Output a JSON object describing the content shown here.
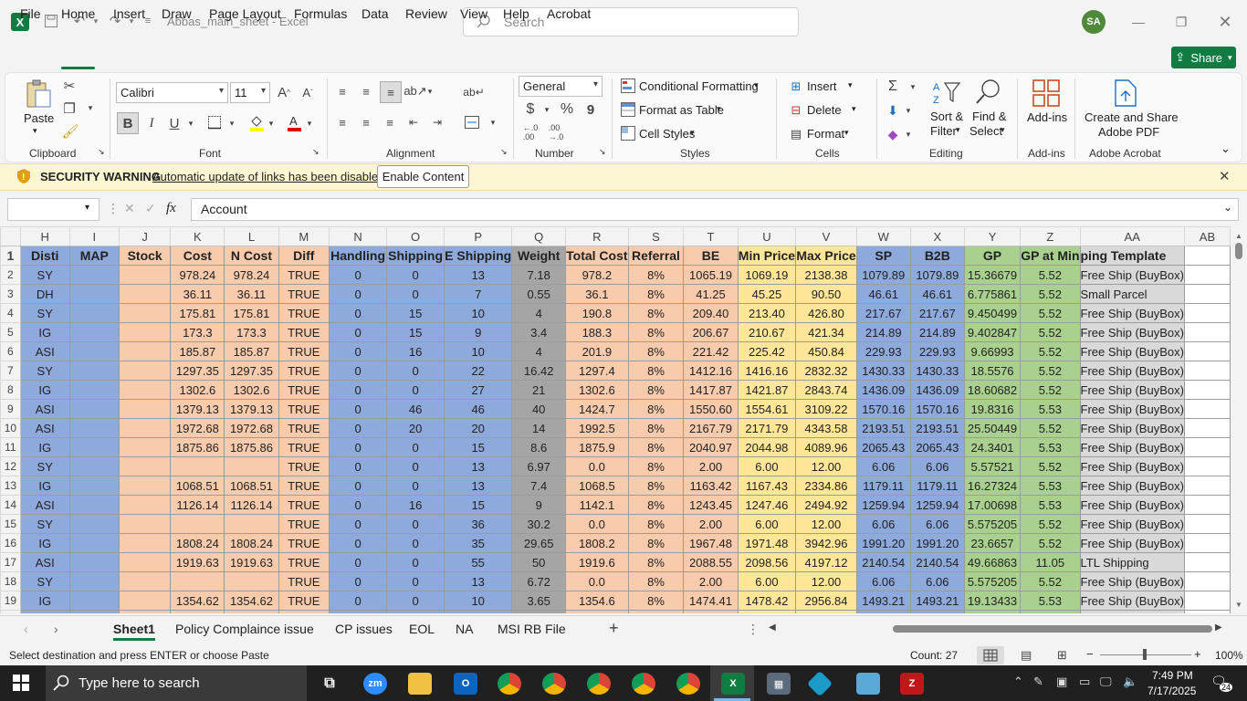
{
  "app": {
    "doc_title": "Abbas_main_sheet  -  Excel",
    "search_placeholder": "Search",
    "user_initials": "SA"
  },
  "menu": {
    "items": [
      "File",
      "Home",
      "Insert",
      "Draw",
      "Page Layout",
      "Formulas",
      "Data",
      "Review",
      "View",
      "Help",
      "Acrobat"
    ],
    "share": "Share"
  },
  "ribbon": {
    "clipboard": {
      "label": "Clipboard",
      "paste": "Paste"
    },
    "font": {
      "label": "Font",
      "name": "Calibri",
      "size": "11",
      "bold": "B",
      "italic": "I",
      "underline": "U"
    },
    "alignment": {
      "label": "Alignment"
    },
    "number": {
      "label": "Number",
      "format": "General",
      "currency": "$",
      "percent": "%",
      "comma": "9"
    },
    "styles": {
      "label": "Styles",
      "conditional": "Conditional Formatting",
      "format_table": "Format as Table",
      "cell_styles": "Cell Styles"
    },
    "cells": {
      "label": "Cells",
      "insert": "Insert",
      "delete": "Delete",
      "format": "Format"
    },
    "editing": {
      "label": "Editing",
      "sort_filter": "Sort &",
      "sort_filter2": "Filter",
      "find_select": "Find &",
      "find_select2": "Select"
    },
    "addins": {
      "label": "Add-ins",
      "addins": "Add-ins"
    },
    "acrobat": {
      "label": "Adobe Acrobat",
      "create": "Create and Share",
      "create2": "Adobe PDF"
    }
  },
  "warning": {
    "title": "SECURITY WARNING",
    "message": "Automatic update of links has been disabled",
    "button": "Enable Content"
  },
  "formula_bar": {
    "name_box": "",
    "fx": "fx",
    "value": "Account"
  },
  "sheet": {
    "columns": [
      "H",
      "I",
      "J",
      "K",
      "L",
      "M",
      "N",
      "O",
      "P",
      "Q",
      "R",
      "S",
      "T",
      "U",
      "V",
      "W",
      "X",
      "Y",
      "Z",
      "AA",
      "AB"
    ],
    "headers": [
      "Disti",
      "MAP",
      "Stock",
      "Cost",
      "N Cost",
      "Diff",
      "Handling",
      "Shipping",
      "E Shipping",
      "Weight",
      "Total Cost",
      "Referral",
      "BE",
      "Min Price",
      "Max Price",
      "SP",
      "B2B",
      "GP",
      "GP at Min",
      "ping Template",
      ""
    ],
    "rows": [
      {
        "n": "2",
        "c": [
          "SY",
          "",
          "",
          "978.24",
          "978.24",
          "TRUE",
          "0",
          "0",
          "13",
          "7.18",
          "978.2",
          "8%",
          "1065.19",
          "1069.19",
          "2138.38",
          "1079.89",
          "1079.89",
          "15.36679",
          "5.52",
          "Free Ship (BuyBox)",
          ""
        ]
      },
      {
        "n": "3",
        "c": [
          "DH",
          "",
          "",
          "36.11",
          "36.11",
          "TRUE",
          "0",
          "0",
          "7",
          "0.55",
          "36.1",
          "8%",
          "41.25",
          "45.25",
          "90.50",
          "46.61",
          "46.61",
          "6.775861",
          "5.52",
          "Small Parcel",
          ""
        ]
      },
      {
        "n": "4",
        "c": [
          "SY",
          "",
          "",
          "175.81",
          "175.81",
          "TRUE",
          "0",
          "15",
          "10",
          "4",
          "190.8",
          "8%",
          "209.40",
          "213.40",
          "426.80",
          "217.67",
          "217.67",
          "9.450499",
          "5.52",
          "Free Ship (BuyBox)",
          ""
        ]
      },
      {
        "n": "5",
        "c": [
          "IG",
          "",
          "",
          "173.3",
          "173.3",
          "TRUE",
          "0",
          "15",
          "9",
          "3.4",
          "188.3",
          "8%",
          "206.67",
          "210.67",
          "421.34",
          "214.89",
          "214.89",
          "9.402847",
          "5.52",
          "Free Ship (BuyBox)",
          ""
        ]
      },
      {
        "n": "6",
        "c": [
          "ASI",
          "",
          "",
          "185.87",
          "185.87",
          "TRUE",
          "0",
          "16",
          "10",
          "4",
          "201.9",
          "8%",
          "221.42",
          "225.42",
          "450.84",
          "229.93",
          "229.93",
          "9.66993",
          "5.52",
          "Free Ship (BuyBox)",
          ""
        ]
      },
      {
        "n": "7",
        "c": [
          "SY",
          "",
          "",
          "1297.35",
          "1297.35",
          "TRUE",
          "0",
          "0",
          "22",
          "16.42",
          "1297.4",
          "8%",
          "1412.16",
          "1416.16",
          "2832.32",
          "1430.33",
          "1430.33",
          "18.5576",
          "5.52",
          "Free Ship (BuyBox)",
          ""
        ]
      },
      {
        "n": "8",
        "c": [
          "IG",
          "",
          "",
          "1302.6",
          "1302.6",
          "TRUE",
          "0",
          "0",
          "27",
          "21",
          "1302.6",
          "8%",
          "1417.87",
          "1421.87",
          "2843.74",
          "1436.09",
          "1436.09",
          "18.60682",
          "5.52",
          "Free Ship (BuyBox)",
          ""
        ]
      },
      {
        "n": "9",
        "c": [
          "ASI",
          "",
          "",
          "1379.13",
          "1379.13",
          "TRUE",
          "0",
          "46",
          "46",
          "40",
          "1424.7",
          "8%",
          "1550.60",
          "1554.61",
          "3109.22",
          "1570.16",
          "1570.16",
          "19.8316",
          "5.53",
          "Free Ship (BuyBox)",
          ""
        ]
      },
      {
        "n": "10",
        "c": [
          "ASI",
          "",
          "",
          "1972.68",
          "1972.68",
          "TRUE",
          "0",
          "20",
          "20",
          "14",
          "1992.5",
          "8%",
          "2167.79",
          "2171.79",
          "4343.58",
          "2193.51",
          "2193.51",
          "25.50449",
          "5.52",
          "Free Ship (BuyBox)",
          ""
        ]
      },
      {
        "n": "11",
        "c": [
          "IG",
          "",
          "",
          "1875.86",
          "1875.86",
          "TRUE",
          "0",
          "0",
          "15",
          "8.6",
          "1875.9",
          "8%",
          "2040.97",
          "2044.98",
          "4089.96",
          "2065.43",
          "2065.43",
          "24.3401",
          "5.53",
          "Free Ship (BuyBox)",
          ""
        ]
      },
      {
        "n": "12",
        "c": [
          "SY",
          "",
          "",
          "",
          "",
          "TRUE",
          "0",
          "0",
          "13",
          "6.97",
          "0.0",
          "8%",
          "2.00",
          "6.00",
          "12.00",
          "6.06",
          "6.06",
          "5.57521",
          "5.52",
          "Free Ship (BuyBox)",
          ""
        ]
      },
      {
        "n": "13",
        "c": [
          "IG",
          "",
          "",
          "1068.51",
          "1068.51",
          "TRUE",
          "0",
          "0",
          "13",
          "7.4",
          "1068.5",
          "8%",
          "1163.42",
          "1167.43",
          "2334.86",
          "1179.11",
          "1179.11",
          "16.27324",
          "5.53",
          "Free Ship (BuyBox)",
          ""
        ]
      },
      {
        "n": "14",
        "c": [
          "ASI",
          "",
          "",
          "1126.14",
          "1126.14",
          "TRUE",
          "0",
          "16",
          "15",
          "9",
          "1142.1",
          "8%",
          "1243.45",
          "1247.46",
          "2494.92",
          "1259.94",
          "1259.94",
          "17.00698",
          "5.53",
          "Free Ship (BuyBox)",
          ""
        ]
      },
      {
        "n": "15",
        "c": [
          "SY",
          "",
          "",
          "",
          "",
          "TRUE",
          "0",
          "0",
          "36",
          "30.2",
          "0.0",
          "8%",
          "2.00",
          "6.00",
          "12.00",
          "6.06",
          "6.06",
          "5.575205",
          "5.52",
          "Free Ship (BuyBox)",
          ""
        ]
      },
      {
        "n": "16",
        "c": [
          "IG",
          "",
          "",
          "1808.24",
          "1808.24",
          "TRUE",
          "0",
          "0",
          "35",
          "29.65",
          "1808.2",
          "8%",
          "1967.48",
          "1971.48",
          "3942.96",
          "1991.20",
          "1991.20",
          "23.6657",
          "5.52",
          "Free Ship (BuyBox)",
          ""
        ]
      },
      {
        "n": "17",
        "c": [
          "ASI",
          "",
          "",
          "1919.63",
          "1919.63",
          "TRUE",
          "0",
          "0",
          "55",
          "50",
          "1919.6",
          "8%",
          "2088.55",
          "2098.56",
          "4197.12",
          "2140.54",
          "2140.54",
          "49.66863",
          "11.05",
          "LTL Shipping",
          ""
        ]
      },
      {
        "n": "18",
        "c": [
          "SY",
          "",
          "",
          "",
          "",
          "TRUE",
          "0",
          "0",
          "13",
          "6.72",
          "0.0",
          "8%",
          "2.00",
          "6.00",
          "12.00",
          "6.06",
          "6.06",
          "5.575205",
          "5.52",
          "Free Ship (BuyBox)",
          ""
        ]
      },
      {
        "n": "19",
        "c": [
          "IG",
          "",
          "",
          "1354.62",
          "1354.62",
          "TRUE",
          "0",
          "0",
          "10",
          "3.65",
          "1354.6",
          "8%",
          "1474.41",
          "1478.42",
          "2956.84",
          "1493.21",
          "1493.21",
          "19.13433",
          "5.53",
          "Free Ship (BuyBox)",
          ""
        ]
      }
    ]
  },
  "sheet_tabs": [
    "Sheet1",
    "Policy Complaince issue",
    "CP issues",
    "EOL",
    "NA",
    "MSI RB File"
  ],
  "status": {
    "message": "Select destination and press ENTER or choose Paste",
    "count": "Count: 27",
    "zoom": "100%"
  },
  "taskbar": {
    "search_placeholder": "Type here to search",
    "time": "7:49 PM",
    "date": "7/17/2025",
    "notifications": "24"
  },
  "colors": {
    "excel_green": "#107c41",
    "col_blue": "#8ea9db",
    "col_peach": "#f8cbad",
    "col_gray": "#a5a5a5",
    "col_yellow": "#ffe699",
    "col_green": "#a9d08e",
    "col_lightgray": "#d9d9d9"
  }
}
